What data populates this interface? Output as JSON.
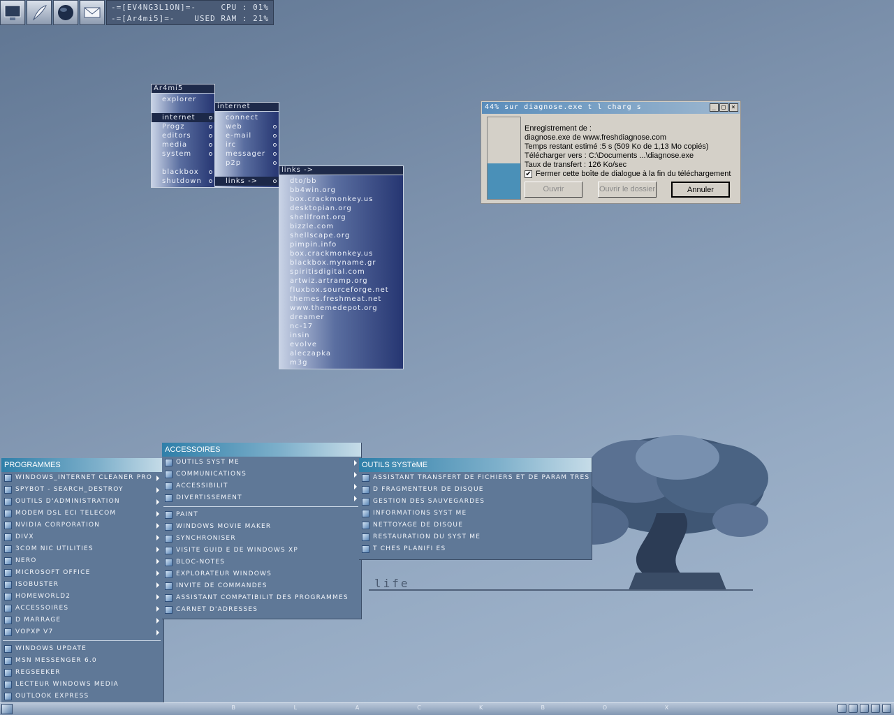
{
  "launcher": {
    "items": [
      {
        "icon": "monitor-icon"
      },
      {
        "icon": "feather-icon"
      },
      {
        "icon": "globe-icon"
      },
      {
        "icon": "mail-icon"
      }
    ]
  },
  "stats": {
    "line1_user": "-=[EV4NG3L1ON]=-",
    "line1_cpu": "CPU : 01%",
    "line2_user": "-=[Ar4mi5]=-",
    "line2_ram": "USED RAM : 21%"
  },
  "bb_root": {
    "title": "Ar4mi5",
    "items": [
      {
        "label": "explorer",
        "sub": false,
        "selected": false
      },
      {
        "label": "",
        "gap": true
      },
      {
        "label": "internet",
        "sub": true,
        "selected": true
      },
      {
        "label": "Progz",
        "sub": true
      },
      {
        "label": "editors",
        "sub": true
      },
      {
        "label": "media",
        "sub": true
      },
      {
        "label": "system",
        "sub": true
      },
      {
        "label": "",
        "gap": true
      },
      {
        "label": "blackbox",
        "sub": true
      },
      {
        "label": "shutdown",
        "sub": true
      }
    ]
  },
  "bb_internet": {
    "title": "internet",
    "items": [
      {
        "label": "connect",
        "sub": false
      },
      {
        "label": "web",
        "sub": true
      },
      {
        "label": "e-mail",
        "sub": true
      },
      {
        "label": "irc",
        "sub": true
      },
      {
        "label": "messager",
        "sub": true
      },
      {
        "label": "p2p",
        "sub": true
      },
      {
        "label": "",
        "gap": true
      },
      {
        "label": "links ->",
        "sub": true,
        "selected": true
      }
    ]
  },
  "bb_links": {
    "title": "links ->",
    "items": [
      "dto/bb",
      "bb4win.org",
      "box.crackmonkey.us",
      "desktopian.org",
      "shellfront.org",
      "bizzle.com",
      "shellscape.org",
      "pimpin.info",
      "box.crackmonkey.us",
      "blackbox.myname.gr",
      "spiritisdigital.com",
      "artwiz.artramp.org",
      "fluxbox.sourceforge.net",
      "themes.freshmeat.net",
      "www.themedepot.org",
      "dreamer",
      "nc-17",
      "insin",
      "evolve",
      "aleczapka",
      "m3g"
    ]
  },
  "dialog": {
    "title": "44% sur diagnose.exe t  l  charg  s",
    "progress": 0.44,
    "lines": [
      "Enregistrement de :",
      "diagnose.exe de www.freshdiagnose.com",
      "Temps restant estimé :5 s (509 Ko de 1,13 Mo copiés)",
      "Télécharger vers :  C:\\Documents ...\\diagnose.exe",
      "Taux de transfert :  126 Ko/sec"
    ],
    "checkbox_label": "Fermer cette boîte de dialogue à la fin du téléchargement",
    "checkbox_checked": true,
    "buttons": {
      "open": "Ouvrir",
      "open_folder": "Ouvrir le dossier",
      "cancel": "Annuler"
    },
    "controls": [
      "_",
      "□",
      "×"
    ]
  },
  "programmes": {
    "header": "PROGRAMMES",
    "items": [
      {
        "label": "Windows_Internet Cleaner Pro",
        "sub": true
      },
      {
        "label": "Spybot - Search_Destroy",
        "sub": true
      },
      {
        "label": "Outils d'administration",
        "sub": true
      },
      {
        "label": "Modem DSL ECI Telecom",
        "sub": true
      },
      {
        "label": "NVIDIA Corporation",
        "sub": true
      },
      {
        "label": "DivX",
        "sub": true
      },
      {
        "label": "3Com NIC Utilities",
        "sub": true
      },
      {
        "label": "Nero",
        "sub": true
      },
      {
        "label": "Microsoft Office",
        "sub": true
      },
      {
        "label": "IsoBuster",
        "sub": true
      },
      {
        "label": "Homeworld2",
        "sub": true
      },
      {
        "label": "Accessoires",
        "sub": true
      },
      {
        "label": "D  marrage",
        "sub": true
      },
      {
        "label": "VopXP v7",
        "sub": true
      }
    ],
    "pinned": [
      "Windows Update",
      "MSN Messenger 6.0",
      "RegSeeker",
      "Lecteur Windows Media",
      "Outlook Express"
    ]
  },
  "accessoires": {
    "header": "ACCESSOIRES",
    "items": [
      {
        "label": "Outils syst  me",
        "sub": true
      },
      {
        "label": "Communications",
        "sub": true
      },
      {
        "label": "Accessibilit",
        "sub": true
      },
      {
        "label": "Divertissement",
        "sub": true
      }
    ],
    "apps": [
      "Paint",
      "Windows Movie Maker",
      "Synchroniser",
      "Visite guid  e de Windows XP",
      "Bloc-notes",
      "Explorateur Windows",
      "Invite de commandes",
      "Assistant Compatibilit   des programmes",
      "Carnet d'adresses"
    ]
  },
  "outils": {
    "header": "OUTILS SYSTèME",
    "items": [
      "Assistant Transfert de fichiers et de param  tres",
      "D  fragmenteur de disque",
      "Gestion des sauvegardes",
      "Informations syst  me",
      "Nettoyage de disque",
      "Restauration du syst  me",
      "T  ches planifi  es"
    ]
  },
  "desktop": {
    "caption": "life"
  },
  "taskbar": {
    "letters": [
      "B",
      "L",
      "A",
      "C",
      "K",
      "B",
      "O",
      "X"
    ]
  }
}
